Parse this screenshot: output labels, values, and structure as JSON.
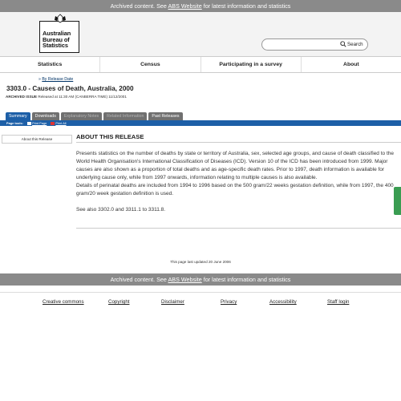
{
  "archive_banner": {
    "prefix": "Archived content. See ",
    "link": "ABS Website",
    "suffix": " for latest information and statistics"
  },
  "logo": {
    "line1": "Australian",
    "line2": "Bureau of",
    "line3": "Statistics"
  },
  "search": {
    "placeholder": "",
    "button_label": "Search"
  },
  "nav": {
    "items": [
      "Statistics",
      "Census",
      "Participating in a survey",
      "About"
    ]
  },
  "by_release_date": "By Release Date",
  "page_title": "3303.0 - Causes of Death, Australia, 2000",
  "archived_issue": {
    "label": "ARCHIVED ISSUE",
    "text": " Released at 11:30 AM (CANBERRA TIME) 11/12/2001"
  },
  "tabs": [
    "Summary",
    "Downloads",
    "Explanatory Notes",
    "Related Information",
    "Past Releases"
  ],
  "toolbar": {
    "label": "Page tools:",
    "print_page": "Print Page",
    "print_all": "Print All"
  },
  "side_box": "About this Release",
  "section_title": "ABOUT THIS RELEASE",
  "body": {
    "p1": "Presents statistics on the number of deaths by state or territory of Australia, sex, selected age groups, and cause of death classified to the World Health Organisation's International Classification of Diseases (ICD). Version 10 of the ICD has been introduced from 1999. Major causes are also shown as a proportion of total deaths and as age-specific death rates. Prior to 1997, death information is available for underlying cause only, while from 1997 onwards, information relating to multiple causes is also available.",
    "p2": "Details of perinatal deaths are included from 1994 to 1996 based on the 500 gram/22 weeks gestation definition, while from 1997, the 400 gram/20 week gestation definition is used."
  },
  "see_also": "See also 3302.0 and 3311.1 to 3311.8.",
  "last_updated": "This page last updated 20 June 2006",
  "footer": {
    "links": [
      "Creative commons",
      "Copyright",
      "Disclaimer",
      "Privacy",
      "Accessibility",
      "Staff login"
    ]
  },
  "colors": {
    "archive_bar": "#8a8a8a",
    "tab_active": "#1d5fa7",
    "tab_inactive": "#707070",
    "feedback_tab": "#3a9d52"
  }
}
